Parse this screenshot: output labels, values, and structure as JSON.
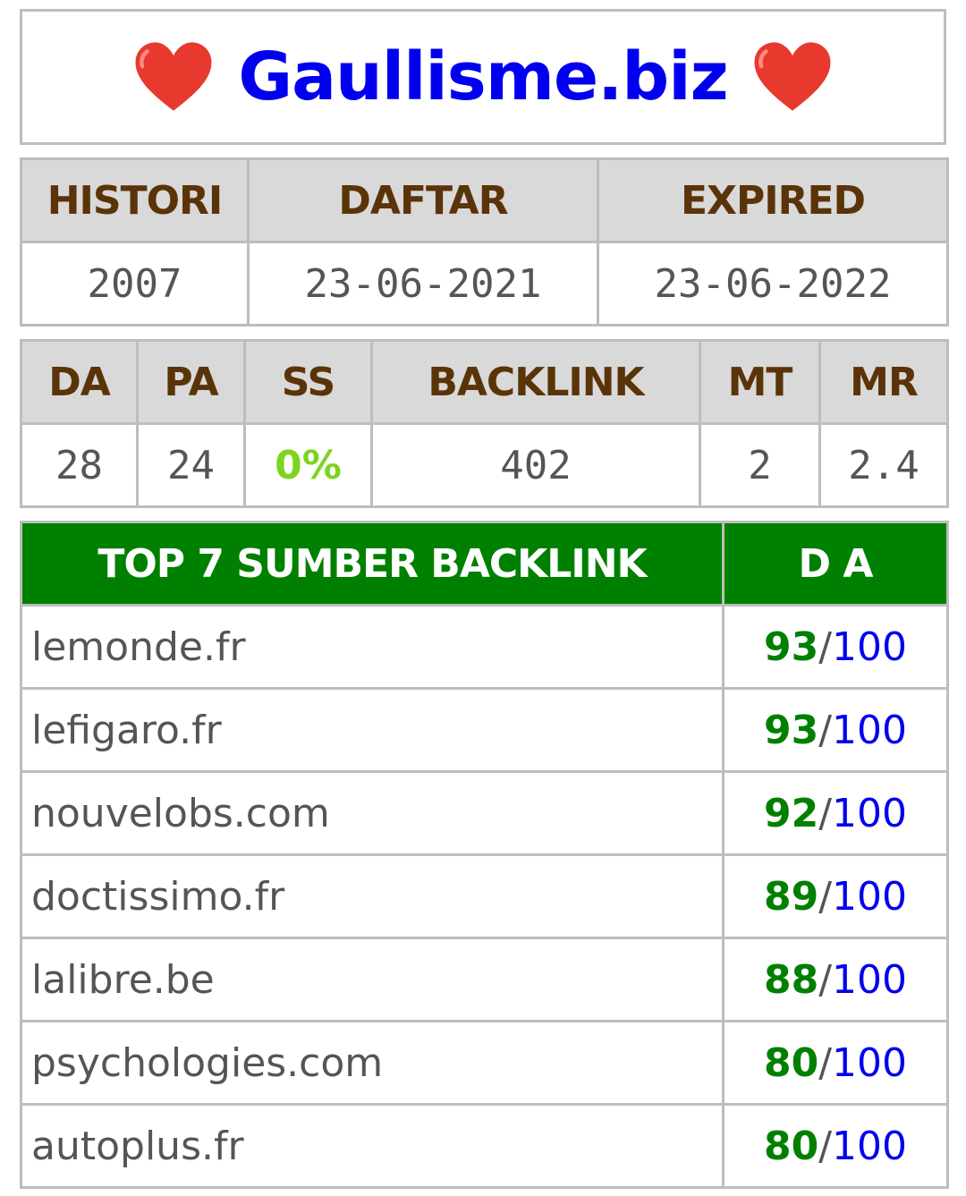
{
  "title": "Gaullisme.biz",
  "heart_icon_color": "#e8392f",
  "info": {
    "headers": [
      "HISTORI",
      "DAFTAR",
      "EXPIRED"
    ],
    "values": [
      "2007",
      "23-06-2021",
      "23-06-2022"
    ]
  },
  "metrics": {
    "headers": [
      "DA",
      "PA",
      "SS",
      "BACKLINK",
      "MT",
      "MR"
    ],
    "values": [
      "28",
      "24",
      "0%",
      "402",
      "2",
      "2.4"
    ]
  },
  "backlinks": {
    "header_source": "TOP 7 SUMBER BACKLINK",
    "header_da": "D A",
    "separator": "/",
    "max": "100",
    "rows": [
      {
        "domain": "lemonde.fr",
        "da": "93"
      },
      {
        "domain": "lefigaro.fr",
        "da": "93"
      },
      {
        "domain": "nouvelobs.com",
        "da": "92"
      },
      {
        "domain": "doctissimo.fr",
        "da": "89"
      },
      {
        "domain": "lalibre.be",
        "da": "88"
      },
      {
        "domain": "psychologies.com",
        "da": "80"
      },
      {
        "domain": "autoplus.fr",
        "da": "80"
      }
    ]
  }
}
